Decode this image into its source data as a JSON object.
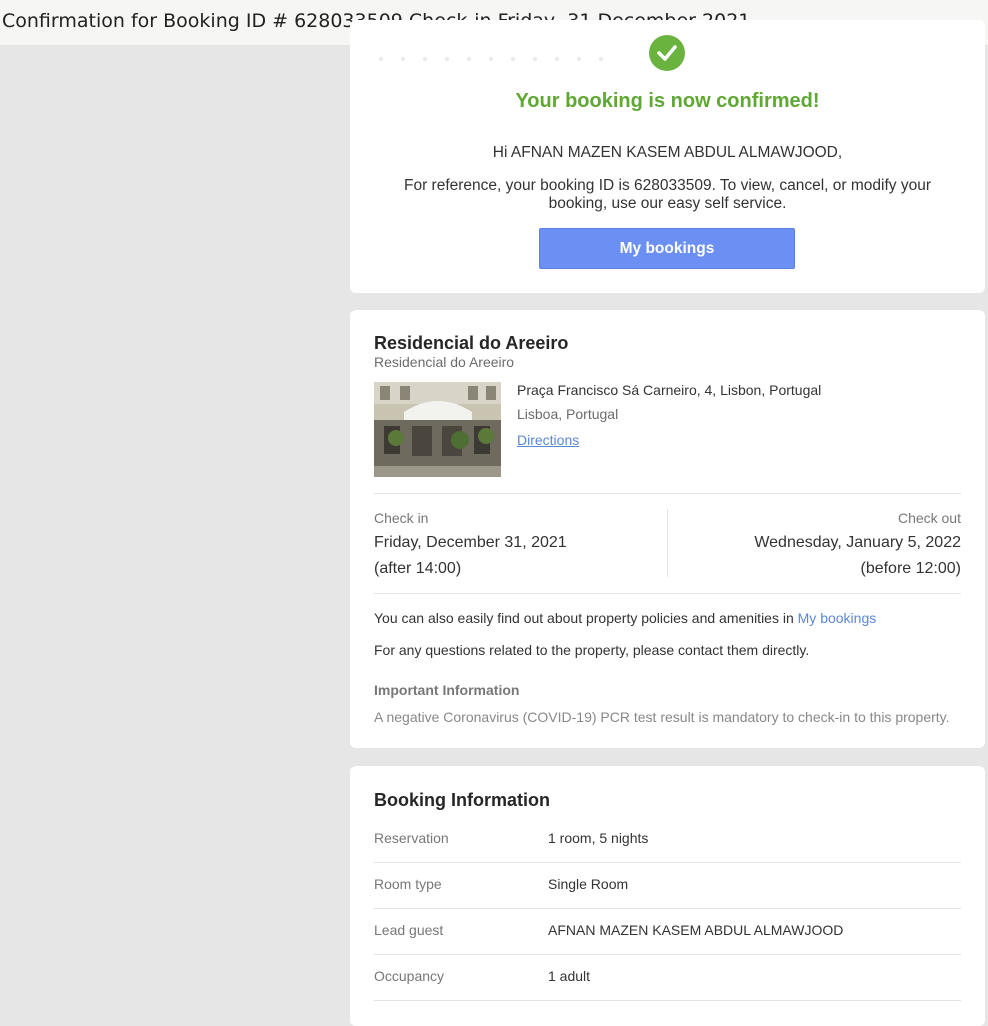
{
  "window": {
    "title": "Confirmation for Booking ID # 628033509 Check-in Friday, 31 December 2021"
  },
  "confirmation": {
    "heading": "Your booking is now confirmed!",
    "greeting": "Hi AFNAN MAZEN KASEM ABDUL ALMAWJOOD,",
    "reference": "For reference, your booking ID is 628033509. To view, cancel, or modify your booking, use our easy self service.",
    "button_label": "My bookings",
    "icon": "checkmark-circle-icon"
  },
  "property": {
    "name": "Residencial do Areeiro",
    "subtitle": "Residencial do Areeiro",
    "address": "Praça Francisco Sá Carneiro, 4, Lisbon, Portugal",
    "city": "Lisboa, Portugal",
    "directions_label": "Directions",
    "check_in": {
      "label": "Check in",
      "date": "Friday, December 31, 2021",
      "time": "(after 14:00)"
    },
    "check_out": {
      "label": "Check out",
      "date": "Wednesday, January 5, 2022",
      "time": "(before 12:00)"
    },
    "policy_text": "You can also easily find out about property policies and amenities in",
    "policy_link": "My bookings",
    "contact_text": "For any questions related to the property, please contact them directly.",
    "important_heading": "Important Information",
    "important_text": "A negative Coronavirus (COVID-19) PCR test result is mandatory to check-in to this property."
  },
  "booking_info": {
    "heading": "Booking Information",
    "rows": [
      {
        "label": "Reservation",
        "value": "1 room, 5 nights"
      },
      {
        "label": "Room type",
        "value": "Single Room"
      },
      {
        "label": "Lead guest",
        "value": "AFNAN MAZEN KASEM ABDUL ALMAWJOOD"
      },
      {
        "label": "Occupancy",
        "value": "1 adult"
      }
    ]
  },
  "colors": {
    "confirmed_green": "#5fa833",
    "button_blue": "#6c8ff3",
    "link_blue": "#5b87d9",
    "background_gray": "#e6e6e6"
  }
}
